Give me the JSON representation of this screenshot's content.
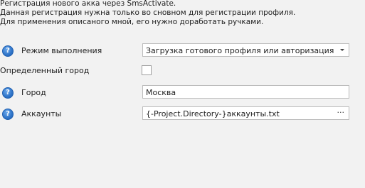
{
  "description": {
    "line1": "Регистрация нового акка через SmsActivate.",
    "line2": "Данная регистрация нужна только во сновном для регистрации профиля.",
    "line3": "Для применения описаного мной, его нужно доработать ручками."
  },
  "settings": {
    "mode": {
      "label": "Режим выполнения",
      "value": "Загрузка готового профиля или авторизация"
    },
    "specific_city": {
      "label": "Определенный город",
      "checked": false
    },
    "city": {
      "label": "Город",
      "value": "Москва"
    },
    "accounts": {
      "label": "Аккаунты",
      "value": "{-Project.Directory-}аккаунты.txt",
      "browse_label": "···"
    }
  },
  "icons": {
    "help": "question-circle-icon",
    "dropdown": "chevron-down-icon"
  },
  "colors": {
    "background": "#f2f2f2",
    "help_icon": "#2f74c8"
  }
}
